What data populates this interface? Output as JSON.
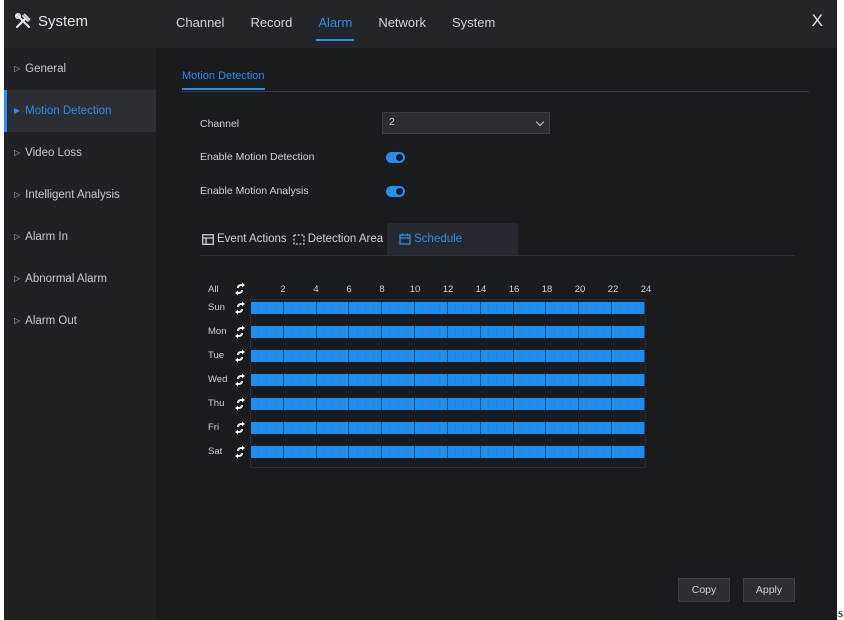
{
  "app": {
    "title": "System"
  },
  "nav": {
    "tabs": [
      {
        "label": "Channel"
      },
      {
        "label": "Record"
      },
      {
        "label": "Alarm"
      },
      {
        "label": "Network"
      },
      {
        "label": "System"
      }
    ],
    "active": "Alarm"
  },
  "close_label": "X",
  "sidebar": {
    "items": [
      {
        "label": "General"
      },
      {
        "label": "Motion Detection"
      },
      {
        "label": "Video Loss"
      },
      {
        "label": "Intelligent Analysis"
      },
      {
        "label": "Alarm In"
      },
      {
        "label": "Abnormal Alarm"
      },
      {
        "label": "Alarm Out"
      }
    ],
    "active": "Motion Detection"
  },
  "page": {
    "tab_label": "Motion Detection"
  },
  "form": {
    "channel_label": "Channel",
    "channel_value": "2",
    "enable_motion_detection_label": "Enable Motion Detection",
    "enable_motion_detection": true,
    "enable_motion_analysis_label": "Enable Motion Analysis",
    "enable_motion_analysis": true
  },
  "subtabs": [
    {
      "label": "Event Actions",
      "icon": "event-actions-icon"
    },
    {
      "label": "Detection Area",
      "icon": "detection-area-icon"
    },
    {
      "label": "Schedule",
      "icon": "calendar-icon"
    }
  ],
  "schedule": {
    "all_label": "All",
    "hour_labels": [
      "2",
      "4",
      "6",
      "8",
      "10",
      "12",
      "14",
      "16",
      "18",
      "20",
      "22",
      "24"
    ],
    "days": [
      "Sun",
      "Mon",
      "Tue",
      "Wed",
      "Thu",
      "Fri",
      "Sat"
    ],
    "slots_per_day": 48,
    "all_slots_enabled": true
  },
  "buttons": {
    "copy": "Copy",
    "apply": "Apply"
  },
  "colors": {
    "accent": "#2a8df0",
    "schedule_fill": "#1a8ff0",
    "background": "#1a1c20"
  },
  "page_suffix": "s"
}
